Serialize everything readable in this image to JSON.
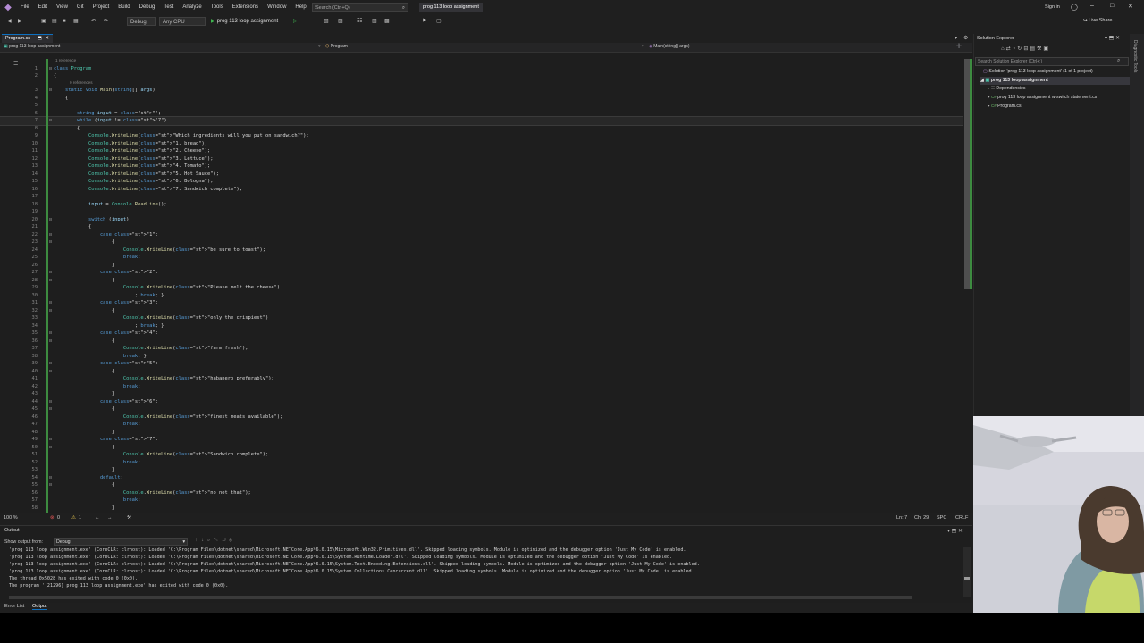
{
  "menu": {
    "items": [
      "File",
      "Edit",
      "View",
      "Git",
      "Project",
      "Build",
      "Debug",
      "Test",
      "Analyze",
      "Tools",
      "Extensions",
      "Window",
      "Help"
    ],
    "search_placeholder": "Search (Ctrl+Q)",
    "project_title": "prog 113 loop assignment",
    "sign_in": "Sign in"
  },
  "toolbar": {
    "config": "Debug",
    "platform": "Any CPU",
    "run_label": "prog 113 loop assignment",
    "live_share": "Live Share"
  },
  "editor": {
    "tab": "Program.cs",
    "nav_project": "prog 113 loop assignment",
    "nav_class": "Program",
    "nav_member": "Main(string[] args)",
    "zoom": "100 %",
    "errors": "0",
    "warnings": "1",
    "ln": "Ln: 7",
    "ch": "Ch: 29",
    "spc": "SPC",
    "crlf": "CRLF",
    "codelens_1": "1 reference",
    "codelens_0": "0 references",
    "lines": [
      {
        "n": "1",
        "t": "class Program"
      },
      {
        "n": "2",
        "t": "{"
      },
      {
        "n": "3",
        "t": "    static void Main(string[] args)"
      },
      {
        "n": "4",
        "t": "    {"
      },
      {
        "n": "5",
        "t": ""
      },
      {
        "n": "6",
        "t": "        string input = \"\";"
      },
      {
        "n": "7",
        "t": "        while (input != \"7\")"
      },
      {
        "n": "8",
        "t": "        {"
      },
      {
        "n": "9",
        "t": "            Console.WriteLine(\"Which ingredients will you put on sandwich?\");"
      },
      {
        "n": "10",
        "t": "            Console.WriteLine(\"1. bread\");"
      },
      {
        "n": "11",
        "t": "            Console.WriteLine(\"2. Cheese\");"
      },
      {
        "n": "12",
        "t": "            Console.WriteLine(\"3. Lettuce\");"
      },
      {
        "n": "13",
        "t": "            Console.WriteLine(\"4. Tomato\");"
      },
      {
        "n": "14",
        "t": "            Console.WriteLine(\"5. Hot Sauce\");"
      },
      {
        "n": "15",
        "t": "            Console.WriteLine(\"6. Bologna\");"
      },
      {
        "n": "16",
        "t": "            Console.WriteLine(\"7. Sandwich complete\");"
      },
      {
        "n": "17",
        "t": ""
      },
      {
        "n": "18",
        "t": "            input = Console.ReadLine();"
      },
      {
        "n": "19",
        "t": ""
      },
      {
        "n": "20",
        "t": "            switch (input)"
      },
      {
        "n": "21",
        "t": "            {"
      },
      {
        "n": "22",
        "t": "                case \"1\":"
      },
      {
        "n": "23",
        "t": "                    {"
      },
      {
        "n": "24",
        "t": "                        Console.WriteLine(\"be sure to toast\");"
      },
      {
        "n": "25",
        "t": "                        break;"
      },
      {
        "n": "26",
        "t": "                    }"
      },
      {
        "n": "27",
        "t": "                case \"2\":"
      },
      {
        "n": "28",
        "t": "                    {"
      },
      {
        "n": "29",
        "t": "                        Console.WriteLine(\"Please melt the cheese\")"
      },
      {
        "n": "30",
        "t": "                            ; break; }"
      },
      {
        "n": "31",
        "t": "                case \"3\":"
      },
      {
        "n": "32",
        "t": "                    {"
      },
      {
        "n": "33",
        "t": "                        Console.WriteLine(\"only the crispiest\")"
      },
      {
        "n": "34",
        "t": "                            ; break; }"
      },
      {
        "n": "35",
        "t": "                case \"4\":"
      },
      {
        "n": "36",
        "t": "                    {"
      },
      {
        "n": "37",
        "t": "                        Console.WriteLine(\"farm fresh\");"
      },
      {
        "n": "38",
        "t": "                        break; }"
      },
      {
        "n": "39",
        "t": "                case \"5\":"
      },
      {
        "n": "40",
        "t": "                    {"
      },
      {
        "n": "41",
        "t": "                        Console.WriteLine(\"habanero preferably\");"
      },
      {
        "n": "42",
        "t": "                        break;"
      },
      {
        "n": "43",
        "t": "                    }"
      },
      {
        "n": "44",
        "t": "                case \"6\":"
      },
      {
        "n": "45",
        "t": "                    {"
      },
      {
        "n": "46",
        "t": "                        Console.WriteLine(\"finest meats available\");"
      },
      {
        "n": "47",
        "t": "                        break;"
      },
      {
        "n": "48",
        "t": "                    }"
      },
      {
        "n": "49",
        "t": "                case \"7\":"
      },
      {
        "n": "50",
        "t": "                    {"
      },
      {
        "n": "51",
        "t": "                        Console.WriteLine(\"Sandwich complete\");"
      },
      {
        "n": "52",
        "t": "                        break;"
      },
      {
        "n": "53",
        "t": "                    }"
      },
      {
        "n": "54",
        "t": "                default:"
      },
      {
        "n": "55",
        "t": "                    {"
      },
      {
        "n": "56",
        "t": "                        Console.WriteLine(\"no not that\");"
      },
      {
        "n": "57",
        "t": "                        break;"
      },
      {
        "n": "58",
        "t": "                    }"
      },
      {
        "n": "59",
        "t": "            }"
      }
    ]
  },
  "solution_explorer": {
    "title": "Solution Explorer",
    "search_placeholder": "Search Solution Explorer (Ctrl+;)",
    "solution": "Solution 'prog 113 loop assignment' (1 of 1 project)",
    "project": "prog 113 loop assignment",
    "items": [
      "Dependencies",
      "prog 113 loop assignment w switch statement.cs",
      "Program.cs"
    ],
    "side_tab": "Diagnostic Tools"
  },
  "output": {
    "title": "Output",
    "show_from_label": "Show output from:",
    "source": "Debug",
    "lines": [
      "'prog 113 loop assignment.exe' (CoreCLR: clrhost): Loaded 'C:\\Program Files\\dotnet\\shared\\Microsoft.NETCore.App\\6.0.15\\Microsoft.Win32.Primitives.dll'. Skipped loading symbols. Module is optimized and the debugger option 'Just My Code' is enabled.",
      "'prog 113 loop assignment.exe' (CoreCLR: clrhost): Loaded 'C:\\Program Files\\dotnet\\shared\\Microsoft.NETCore.App\\6.0.15\\System.Runtime.Loader.dll'. Skipped loading symbols. Module is optimized and the debugger option 'Just My Code' is enabled.",
      "'prog 113 loop assignment.exe' (CoreCLR: clrhost): Loaded 'C:\\Program Files\\dotnet\\shared\\Microsoft.NETCore.App\\6.0.15\\System.Text.Encoding.Extensions.dll'. Skipped loading symbols. Module is optimized and the debugger option 'Just My Code' is enabled.",
      "'prog 113 loop assignment.exe' (CoreCLR: clrhost): Loaded 'C:\\Program Files\\dotnet\\shared\\Microsoft.NETCore.App\\6.0.15\\System.Collections.Concurrent.dll'. Skipped loading symbols. Module is optimized and the debugger option 'Just My Code' is enabled.",
      "The thread 0x5028 has exited with code 0 (0x0).",
      "The program '[21296] prog 113 loop assignment.exe' has exited with code 0 (0x0)."
    ],
    "tab_error_list": "Error List",
    "tab_output": "Output"
  }
}
